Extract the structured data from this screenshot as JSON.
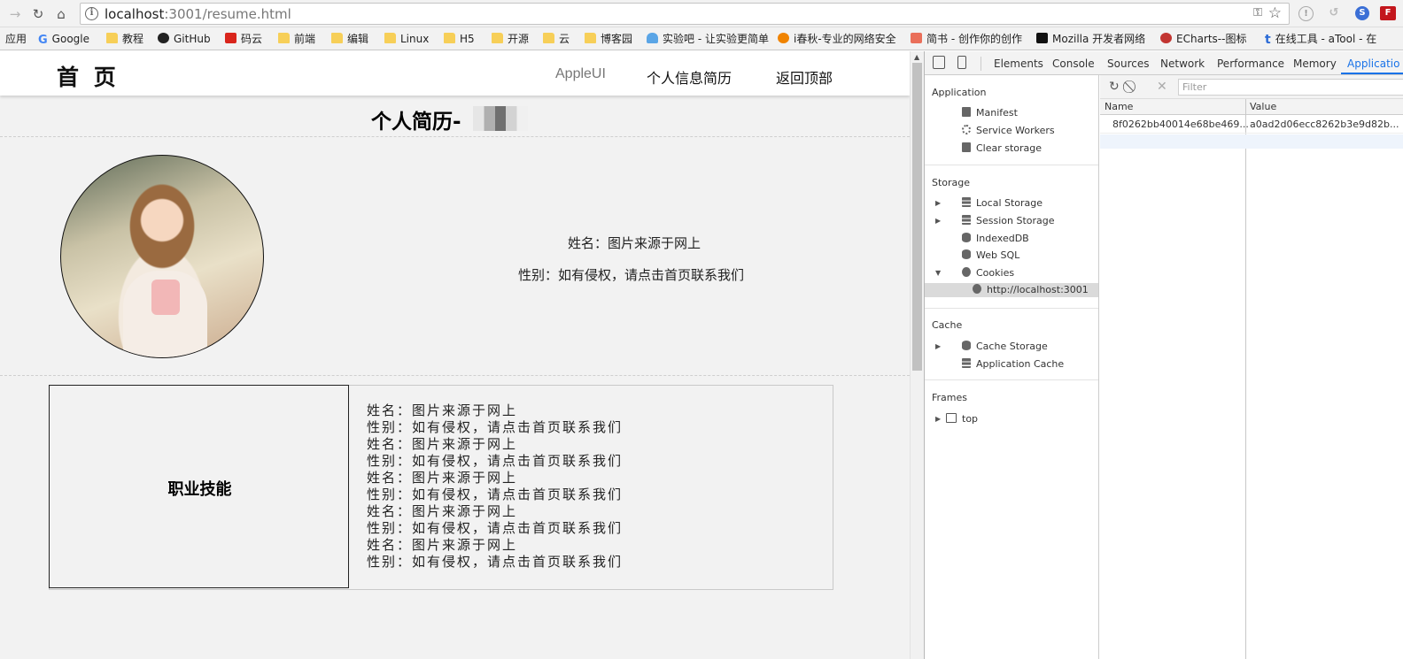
{
  "browser": {
    "url_host": "localhost",
    "url_rest": ":3001/resume.html",
    "bookmarks": [
      {
        "label": "应用",
        "icon": "apps"
      },
      {
        "label": "Google",
        "icon": "google"
      },
      {
        "label": "教程",
        "icon": "folder"
      },
      {
        "label": "GitHub",
        "icon": "github"
      },
      {
        "label": "码云",
        "icon": "gitee"
      },
      {
        "label": "前端",
        "icon": "folder"
      },
      {
        "label": "编辑",
        "icon": "folder"
      },
      {
        "label": "Linux",
        "icon": "folder"
      },
      {
        "label": "H5",
        "icon": "folder"
      },
      {
        "label": "开源",
        "icon": "folder"
      },
      {
        "label": "云",
        "icon": "folder"
      },
      {
        "label": "博客园",
        "icon": "folder"
      },
      {
        "label": "实验吧 - 让实验更简单",
        "icon": "cloud"
      },
      {
        "label": "i春秋-专业的网络安全",
        "icon": "ichunqiu"
      },
      {
        "label": "简书 - 创作你的创作",
        "icon": "jianshu"
      },
      {
        "label": "Mozilla 开发者网络",
        "icon": "mozilla"
      },
      {
        "label": "ECharts--图标",
        "icon": "echarts"
      },
      {
        "label": "在线工具 - aTool - 在",
        "icon": "atool"
      }
    ]
  },
  "site": {
    "logo": "首 页",
    "nav": [
      "AppleUI",
      "个人信息简历",
      "返回顶部"
    ],
    "title": "个人简历-",
    "name_line": "姓名：图片来源于网上",
    "gender_line": "性别：如有侵权，请点击首页联系我们",
    "skills_title": "职业技能",
    "skills_lines": [
      "姓名：图片来源于网上",
      "性别：如有侵权，请点击首页联系我们",
      "姓名：图片来源于网上",
      "性别：如有侵权，请点击首页联系我们",
      "姓名：图片来源于网上",
      "性别：如有侵权，请点击首页联系我们",
      "姓名：图片来源于网上",
      "性别：如有侵权，请点击首页联系我们",
      "姓名：图片来源于网上",
      "性别：如有侵权，请点击首页联系我们"
    ]
  },
  "devtools": {
    "tabs": [
      "Elements",
      "Console",
      "Sources",
      "Network",
      "Performance",
      "Memory",
      "Applicatio"
    ],
    "active_tab": "Applicatio",
    "sections": {
      "application": {
        "heading": "Application",
        "items": [
          "Manifest",
          "Service Workers",
          "Clear storage"
        ]
      },
      "storage": {
        "heading": "Storage",
        "items": [
          "Local Storage",
          "Session Storage",
          "IndexedDB",
          "Web SQL",
          "Cookies"
        ],
        "cookie_origin": "http://localhost:3001"
      },
      "cache": {
        "heading": "Cache",
        "items": [
          "Cache Storage",
          "Application Cache"
        ]
      },
      "frames": {
        "heading": "Frames",
        "items": [
          "top"
        ]
      }
    },
    "filter_placeholder": "Filter",
    "columns": [
      "Name",
      "Value"
    ],
    "cookie_rows": [
      {
        "name": "8f0262bb40014e68be469...",
        "value": "a0ad2d06ecc8262b3e9d82b..."
      }
    ],
    "accent": "#1a73e8"
  }
}
